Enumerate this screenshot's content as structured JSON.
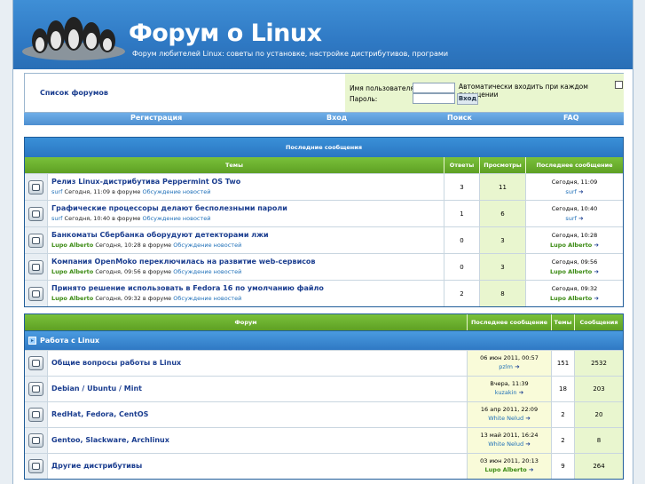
{
  "header": {
    "title": "Форум о Linux",
    "description": "Форум любителей Linux: советы по установке, настройке дистрибутивов, програми"
  },
  "login": {
    "forum_list_label": "Список форумов",
    "username_label": "Имя пользователя:",
    "password_label": "Пароль:",
    "autologin_label": "Автоматически входить при каждом посещении",
    "submit_label": "Вход"
  },
  "nav": [
    "Регистрация",
    "Вход",
    "Поиск",
    "FAQ"
  ],
  "recent": {
    "title": "Последние сообщения",
    "columns": [
      "Темы",
      "Ответы",
      "Просмотры",
      "Последнее сообщение"
    ],
    "rows": [
      {
        "title": "Релиз Linux-дистрибутива Peppermint OS Two",
        "user": "surf",
        "user_style": "plain",
        "date": "Сегодня, 11:09",
        "in_forum": "в форуме",
        "forum": "Обсуждение новостей",
        "replies": "3",
        "views": "11",
        "last_date": "Сегодня, 11:09",
        "last_user": "surf"
      },
      {
        "title": "Графические процессоры делают бесполезными пароли",
        "user": "surf",
        "user_style": "plain",
        "date": "Сегодня, 10:40",
        "in_forum": "в форуме",
        "forum": "Обсуждение новостей",
        "replies": "1",
        "views": "6",
        "last_date": "Сегодня, 10:40",
        "last_user": "surf"
      },
      {
        "title": "Банкоматы Сбербанка оборудуют детекторами лжи",
        "user": "Lupo Alberto",
        "user_style": "green",
        "date": "Сегодня, 10:28",
        "in_forum": "в форуме",
        "forum": "Обсуждение новостей",
        "replies": "0",
        "views": "3",
        "last_date": "Сегодня, 10:28",
        "last_user": "Lupo Alberto"
      },
      {
        "title": "Компания OpenMoko переключилась на развитие web-сервисов",
        "user": "Lupo Alberto",
        "user_style": "green",
        "date": "Сегодня, 09:56",
        "in_forum": "в форуме",
        "forum": "Обсуждение новостей",
        "replies": "0",
        "views": "3",
        "last_date": "Сегодня, 09:56",
        "last_user": "Lupo Alberto"
      },
      {
        "title": "Принято решение использовать в Fedora 16 по умолчанию файло",
        "user": "Lupo Alberto",
        "user_style": "green",
        "date": "Сегодня, 09:32",
        "in_forum": "в форуме",
        "forum": "Обсуждение новостей",
        "replies": "2",
        "views": "8",
        "last_date": "Сегодня, 09:32",
        "last_user": "Lupo Alberto"
      }
    ]
  },
  "forums": {
    "columns": [
      "Форум",
      "Последнее сообщение",
      "Темы",
      "Сообщения"
    ],
    "category": "Работа с Linux",
    "rows": [
      {
        "title": "Общие вопросы работы в Linux",
        "last_date": "06 июн 2011, 00:57",
        "last_user": "pzlm",
        "user_style": "plain",
        "topics": "151",
        "posts": "2532"
      },
      {
        "title": "Debian / Ubuntu / Mint",
        "last_date": "Вчера, 11:39",
        "last_user": "kuzakin",
        "user_style": "plain",
        "topics": "18",
        "posts": "203"
      },
      {
        "title": "RedHat, Fedora, CentOS",
        "last_date": "16 апр 2011, 22:09",
        "last_user": "White Nelud",
        "user_style": "plain",
        "topics": "2",
        "posts": "20"
      },
      {
        "title": "Gentoo, Slackware, Archlinux",
        "last_date": "13 май 2011, 16:24",
        "last_user": "White Nelud",
        "user_style": "plain",
        "topics": "2",
        "posts": "8"
      },
      {
        "title": "Другие дистрибутивы",
        "last_date": "03 июн 2011, 20:13",
        "last_user": "Lupo Alberto",
        "user_style": "green",
        "topics": "9",
        "posts": "264"
      }
    ]
  },
  "colors": {
    "header_blue": "#2f79c4",
    "green": "#6ab02c",
    "link": "#1a3d8f",
    "light_green": "#e9f6cf"
  }
}
